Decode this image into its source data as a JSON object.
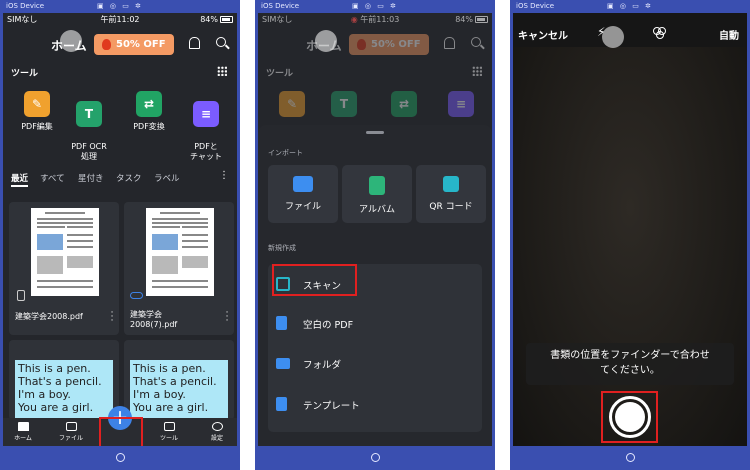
{
  "device_title": "iOS Device",
  "colors": {
    "frame": "#3a4fb0",
    "app_bg": "#24262b",
    "accent": "#3d82e6",
    "promo": "#f49a64",
    "highlight": "#e02020",
    "status_red": "#d13a3a"
  },
  "panel1": {
    "status": {
      "carrier": "SIMなし",
      "time": "午前11:02",
      "battery": "84%"
    },
    "header": {
      "title": "ホーム",
      "promo": "50% OFF"
    },
    "tools_title": "ツール",
    "tools": [
      {
        "label": "PDF編集",
        "icon": "pdf-edit-icon",
        "glyph": "✎",
        "color": "#f0a12e"
      },
      {
        "label": "PDF OCR\n処理",
        "icon": "ocr-icon",
        "glyph": "T",
        "color": "#24a26b"
      },
      {
        "label": "PDF変換",
        "icon": "convert-icon",
        "glyph": "⇄",
        "color": "#21a464"
      },
      {
        "label": "PDFと\nチャット",
        "icon": "chat-icon",
        "glyph": "≡",
        "color": "#7b5cff"
      }
    ],
    "tabs": [
      "最近",
      "すべて",
      "星付き",
      "タスク",
      "ラベル"
    ],
    "files": [
      {
        "name": "建築学会2008.pdf"
      },
      {
        "name": "建築学会\n2008(7).pdf"
      }
    ],
    "note_text": "This is a pen.\nThat's a pencil.\nI'm a boy.\nYou are a girl.",
    "nav": [
      "ホーム",
      "ファイル",
      "",
      "ツール",
      "設定"
    ],
    "fab": "+"
  },
  "panel2": {
    "status": {
      "carrier": "SIMなし",
      "time": "午前11:03",
      "battery": "84%"
    },
    "header": {
      "title": "ホーム",
      "promo": "50% OFF"
    },
    "tools_title": "ツール",
    "import_label": "インポート",
    "import_tiles": [
      {
        "label": "ファイル",
        "icon": "folder-icon",
        "color": "#3d8ef0"
      },
      {
        "label": "アルバム",
        "icon": "album-icon",
        "color": "#2db57a"
      },
      {
        "label": "QR コード",
        "icon": "qr-code-icon",
        "color": "#27b6c9"
      }
    ],
    "new_label": "新規作成",
    "new_items": [
      {
        "label": "スキャン",
        "icon": "scan-icon",
        "color": "#27b6c9"
      },
      {
        "label": "空白の PDF",
        "icon": "blank-pdf-icon",
        "color": "#3d8ef0"
      },
      {
        "label": "フォルダ",
        "icon": "folder-icon",
        "color": "#3d8ef0"
      },
      {
        "label": "テンプレート",
        "icon": "template-icon",
        "color": "#3d8ef0"
      }
    ]
  },
  "panel3": {
    "cancel": "キャンセル",
    "auto": "自動",
    "guide": "書類の位置をファインダーで合わせ\nてください。"
  }
}
